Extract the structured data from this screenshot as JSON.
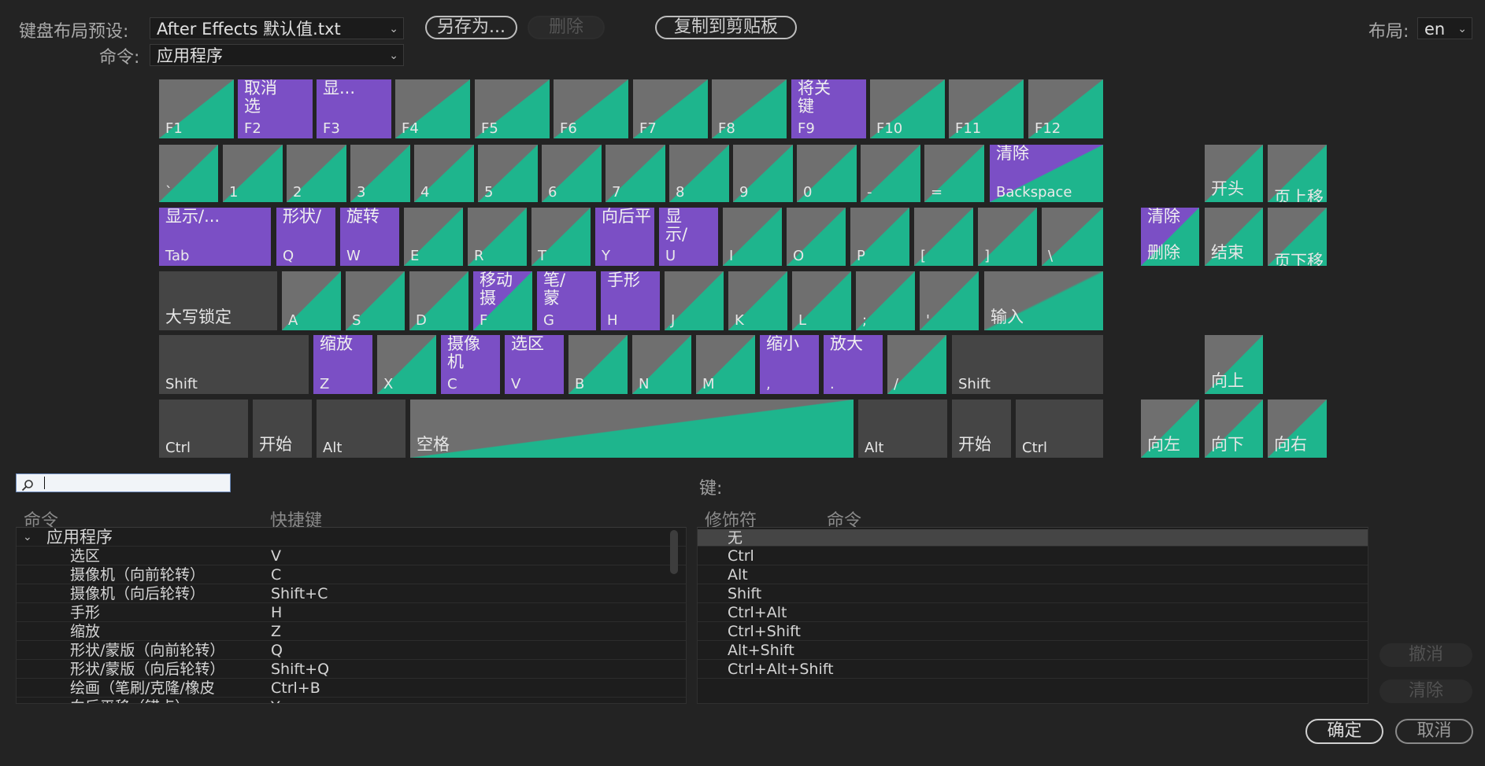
{
  "top": {
    "preset_label": "键盘布局预设:",
    "preset_value": "After Effects 默认值.txt",
    "save_as": "另存为...",
    "delete": "删除",
    "copy": "复制到剪贴板",
    "layout_label": "布局:",
    "layout_value": "en",
    "command_label": "命令:",
    "command_value": "应用程序"
  },
  "keys": {
    "f1": "F1",
    "f2": "F2",
    "f2_cmd": "取消选",
    "f3": "F3",
    "f3_cmd": "显...",
    "f4": "F4",
    "f5": "F5",
    "f6": "F6",
    "f7": "F7",
    "f8": "F8",
    "f9": "F9",
    "f9_cmd": "将关键",
    "f10": "F10",
    "f11": "F11",
    "f12": "F12",
    "backtick": "`",
    "k1": "1",
    "k2": "2",
    "k3": "3",
    "k4": "4",
    "k5": "5",
    "k6": "6",
    "k7": "7",
    "k8": "8",
    "k9": "9",
    "k0": "0",
    "minus": "-",
    "equal": "=",
    "backspace": "Backspace",
    "backspace_cmd": "清除",
    "tab": "Tab",
    "tab_cmd": "显示/...",
    "q": "Q",
    "q_cmd": "形状/",
    "w": "W",
    "w_cmd": "旋转",
    "e": "E",
    "r": "R",
    "t": "T",
    "y": "Y",
    "y_cmd": "向后平",
    "u": "U",
    "u_cmd": "显示/",
    "i": "I",
    "o": "O",
    "p": "P",
    "lbracket": "[",
    "rbracket": "]",
    "backslash": "\\",
    "caps": "大写锁定",
    "a": "A",
    "s": "S",
    "d": "D",
    "f": "F",
    "f_cmd": "移动摄",
    "g": "G",
    "g_cmd": "笔/蒙",
    "h": "H",
    "h_cmd": "手形",
    "j": "J",
    "k": "K",
    "l": "L",
    "semicolon": ";",
    "quote": "'",
    "enter": "输入",
    "lshift": "Shift",
    "z": "Z",
    "z_cmd": "缩放",
    "x": "X",
    "c": "C",
    "c_cmd": "摄像机",
    "v": "V",
    "v_cmd": "选区",
    "b": "B",
    "n": "N",
    "m": "M",
    "comma": ",",
    "comma_cmd": "缩小",
    "period": ".",
    "period_cmd": "放大",
    "slash": "/",
    "rshift": "Shift",
    "lctrl": "Ctrl",
    "lwin": "开始",
    "lalt": "Alt",
    "space": "空格",
    "ralt": "Alt",
    "rwin": "开始",
    "rctrl": "Ctrl",
    "home": "开头",
    "pgup": "页上移",
    "del": "删除",
    "del_cmd": "清除",
    "end": "结束",
    "pgdn": "页下移",
    "up": "向上",
    "left": "向左",
    "down": "向下",
    "right": "向右"
  },
  "left_table": {
    "col_command": "命令",
    "col_shortcut": "快捷键",
    "group": "应用程序",
    "rows": [
      {
        "name": "选区",
        "key": "V"
      },
      {
        "name": "摄像机（向前轮转）",
        "key": "C"
      },
      {
        "name": "摄像机（向后轮转）",
        "key": "Shift+C"
      },
      {
        "name": "手形",
        "key": "H"
      },
      {
        "name": "缩放",
        "key": "Z"
      },
      {
        "name": "形状/蒙版（向前轮转）",
        "key": "Q"
      },
      {
        "name": "形状/蒙版（向后轮转）",
        "key": "Shift+Q"
      },
      {
        "name": "绘画（笔刷/克隆/橡皮",
        "key": "Ctrl+B"
      },
      {
        "name": "向后平移（锚点）",
        "key": "Y"
      }
    ]
  },
  "right_table": {
    "key_label": "键:",
    "col_modifier": "修饰符",
    "col_command": "命令",
    "rows": [
      "无",
      "Ctrl",
      "Alt",
      "Shift",
      "Ctrl+Alt",
      "Ctrl+Shift",
      "Alt+Shift",
      "Ctrl+Alt+Shift"
    ]
  },
  "side_buttons": {
    "undo": "撤消",
    "clear": "清除"
  },
  "footer": {
    "ok": "确定",
    "cancel": "取消"
  }
}
